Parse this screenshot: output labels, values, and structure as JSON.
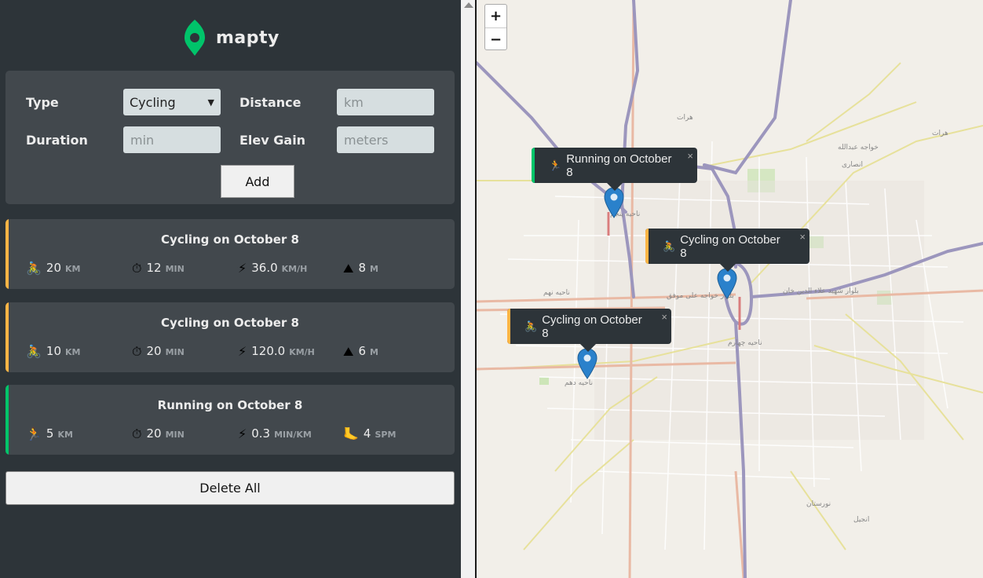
{
  "app": {
    "name": "mapty",
    "brand_color": "#00c46a",
    "cycling_color": "#ffb545",
    "running_color": "#00c46a"
  },
  "form": {
    "type_label": "Type",
    "type_selected": "Cycling",
    "distance_label": "Distance",
    "distance_placeholder": "km",
    "duration_label": "Duration",
    "duration_placeholder": "min",
    "elev_label": "Elev Gain",
    "elev_placeholder": "meters",
    "add_label": "Add"
  },
  "workouts": [
    {
      "type": "cycling",
      "title": "Cycling on October 8",
      "stats": [
        {
          "icon": "🚴",
          "icon_name": "cyclist-icon",
          "value": "20",
          "unit": "km"
        },
        {
          "icon": "⏱",
          "icon_name": "stopwatch-icon",
          "value": "12",
          "unit": "min"
        },
        {
          "icon": "⚡",
          "icon_name": "lightning-icon",
          "value": "36.0",
          "unit": "km/h"
        },
        {
          "icon": "⛰",
          "icon_name": "mountain-icon",
          "value": "8",
          "unit": "m"
        }
      ]
    },
    {
      "type": "cycling",
      "title": "Cycling on October 8",
      "stats": [
        {
          "icon": "🚴",
          "icon_name": "cyclist-icon",
          "value": "10",
          "unit": "km"
        },
        {
          "icon": "⏱",
          "icon_name": "stopwatch-icon",
          "value": "20",
          "unit": "min"
        },
        {
          "icon": "⚡",
          "icon_name": "lightning-icon",
          "value": "120.0",
          "unit": "km/h"
        },
        {
          "icon": "⛰",
          "icon_name": "mountain-icon",
          "value": "6",
          "unit": "m"
        }
      ]
    },
    {
      "type": "running",
      "title": "Running on October 8",
      "stats": [
        {
          "icon": "🏃",
          "icon_name": "runner-icon",
          "value": "5",
          "unit": "km"
        },
        {
          "icon": "⏱",
          "icon_name": "stopwatch-icon",
          "value": "20",
          "unit": "min"
        },
        {
          "icon": "⚡",
          "icon_name": "lightning-icon",
          "value": "0.3",
          "unit": "min/km"
        },
        {
          "icon": "🦶",
          "icon_name": "footprint-icon",
          "value": "4",
          "unit": "spm"
        }
      ]
    }
  ],
  "delete_all_label": "Delete All",
  "map": {
    "zoom_in": "+",
    "zoom_out": "−",
    "popups": [
      {
        "type": "running",
        "icon": "🏃",
        "text": "Running on October 8",
        "close": "×"
      },
      {
        "type": "cycling",
        "icon": "🚴",
        "text": "Cycling on October 8",
        "close": "×"
      },
      {
        "type": "cycling",
        "icon": "🚴",
        "text": "Cycling on October 8",
        "close": "×"
      }
    ],
    "labels": [
      "هرات",
      "هرات",
      "خواجه عبدالله",
      "انصاری",
      "ناحیه پنجم",
      "ناحیه نهم",
      "ناحیه دهم",
      "ناحیه چهارم",
      "نورستان",
      "انجیل",
      "بلوار خواجه علی موفق",
      "بلوار شهید علاء الدین خان"
    ]
  }
}
